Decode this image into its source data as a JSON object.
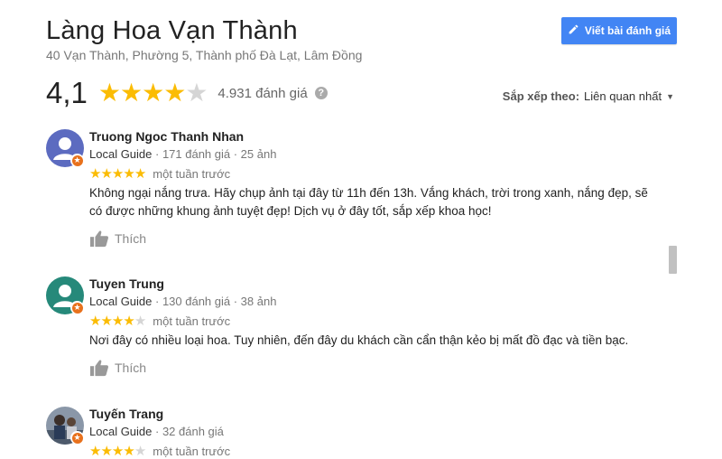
{
  "header": {
    "title": "Làng Hoa Vạn Thành",
    "address": "40 Vạn Thành, Phường 5, Thành phố Đà Lạt, Lâm Đồng",
    "write_review_label": "Viết bài đánh giá"
  },
  "summary": {
    "average": "4,1",
    "stars": 4,
    "count_label": "4.931 đánh giá",
    "help": "?"
  },
  "sort": {
    "label": "Sắp xếp theo:",
    "value": "Liên quan nhất"
  },
  "colors": {
    "accent": "#4285f4",
    "star": "#fbbc04",
    "badge": "#e8711c",
    "avatar1": "#5c6bc0",
    "avatar2": "#26897a"
  },
  "reviews": [
    {
      "name": "Truong Ngoc Thanh Nhan",
      "guide": "Local Guide",
      "stats": " · 171 đánh giá · 25 ảnh",
      "stars": 5,
      "time": "một tuần trước",
      "text": "Không ngại nắng trưa. Hãy chụp ảnh tại đây từ 11h đến 13h. Vắng khách, trời trong xanh, nắng đẹp, sẽ có được những khung ảnh tuyệt đẹp! Dịch vụ ở đây tốt, sắp xếp khoa học!",
      "like_label": "Thích"
    },
    {
      "name": "Tuyen Trung",
      "guide": "Local Guide",
      "stats": " · 130 đánh giá · 38 ảnh",
      "stars": 4,
      "time": "một tuần trước",
      "text": "Nơi đây có nhiều loại hoa. Tuy nhiên, đến đây du khách cần cẩn thận kẻo bị mất đồ đạc và tiền bạc.",
      "like_label": "Thích"
    },
    {
      "name": "Tuyến Trang",
      "guide": "Local Guide",
      "stats": " · 32 đánh giá",
      "stars": 4,
      "time": "một tuần trước"
    }
  ]
}
